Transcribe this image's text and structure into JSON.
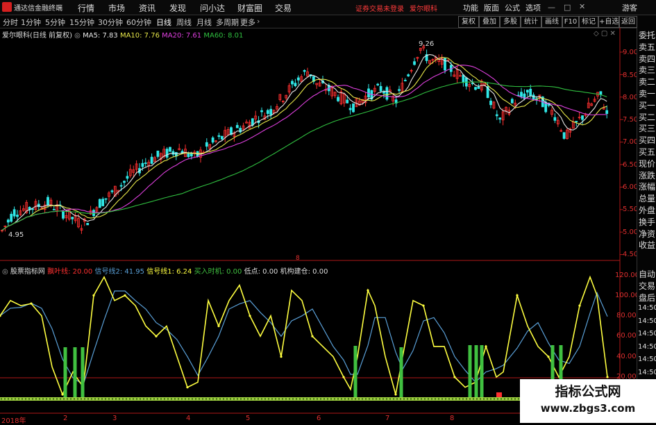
{
  "menubar": {
    "app_title": "通达信金融终端",
    "items": [
      "行情",
      "市场",
      "资讯",
      "发现",
      "问小达",
      "财富圈",
      "交易"
    ],
    "notice": "证券交易未登录",
    "stock_link": "爱尔眼科",
    "right_items": [
      "功能",
      "版面",
      "公式",
      "选项"
    ],
    "guest": "游客"
  },
  "toolbar": {
    "periods": [
      "分时",
      "1分钟",
      "5分钟",
      "15分钟",
      "30分钟",
      "60分钟",
      "日线",
      "周线",
      "月线",
      "多周期",
      "更多"
    ],
    "active_period": "日线",
    "buttons": [
      "复权",
      "叠加",
      "多股",
      "统计",
      "画线",
      "F10",
      "标记",
      "+自选",
      "返回"
    ]
  },
  "main_chart": {
    "title": "爱尔眼科(日线 前复权)",
    "ma5_label": "MA5: 7.83",
    "ma10_label": "MA10: 7.76",
    "ma20_label": "MA20: 7.61",
    "ma60_label": "MA60: 8.01",
    "high_label": "9.26",
    "low_label": "4.95",
    "marker": "8",
    "price_axis": [
      "9.00",
      "8.50",
      "8.00",
      "7.50",
      "7.00",
      "6.50",
      "6.00",
      "5.50",
      "5.00",
      "4.50"
    ]
  },
  "indicator": {
    "title": "股票指标网",
    "line1": "飘叶线: 20.00",
    "line2": "信号线2: 41.95",
    "line3": "信号线1: 6.24",
    "line4": "买入时机: 0.00",
    "line5": "低点: 0.00",
    "line6": "机构建仓: 0.00",
    "axis": [
      "120.00",
      "100.00",
      "80.00",
      "60.00",
      "40.00",
      "20.00"
    ]
  },
  "side_panel": [
    "委托",
    "卖五",
    "卖四",
    "卖三",
    "卖二",
    "卖一",
    "买一",
    "买二",
    "买三",
    "买四",
    "买五",
    "现价",
    "涨跌",
    "涨幅",
    "总量",
    "外盘",
    "换手",
    "净资",
    "收益"
  ],
  "side_panel_lower": [
    "自动",
    "交易",
    "盘后"
  ],
  "side_times": [
    "14:50",
    "14:50",
    "14:50",
    "14:50",
    "14:50",
    "14:50",
    "14:50",
    "14:50"
  ],
  "date_axis": [
    "2018年",
    "2",
    "3",
    "4",
    "5",
    "6",
    "7",
    "8"
  ],
  "watermark": {
    "line1": "指标公式网",
    "line2": "www.zbgs3.com"
  },
  "colors": {
    "up": "#ff3030",
    "down": "#30e8e8",
    "ma5": "#e8e8e8",
    "ma10": "#e8e84a",
    "ma20": "#e040e0",
    "ma60": "#30c040",
    "signal_yellow": "#ffff40",
    "signal_blue": "#5aa0d8",
    "buy_bar": "#40c040",
    "axis_red": "#b01818"
  }
}
